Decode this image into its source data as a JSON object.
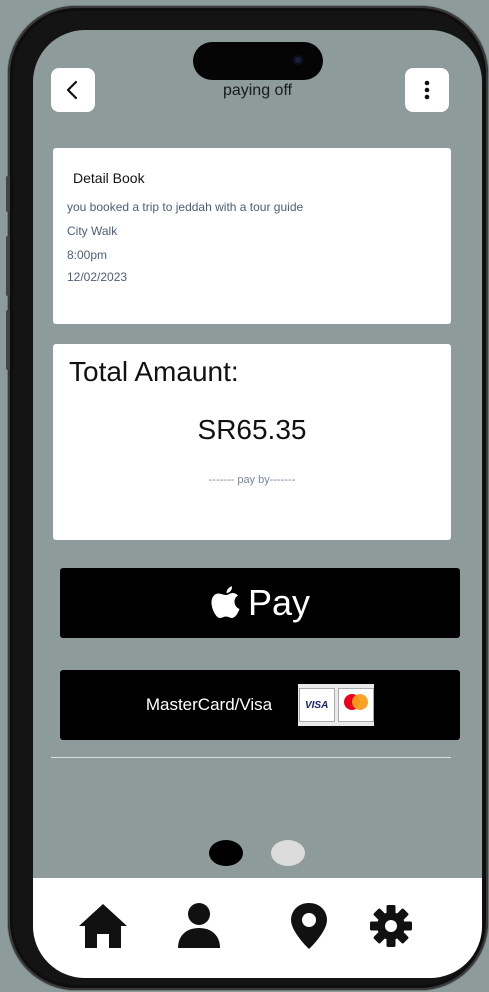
{
  "header": {
    "title": "paying off",
    "back_icon": "chevron-left-icon",
    "menu_icon": "more-vertical-icon"
  },
  "detail": {
    "heading": "Detail Book",
    "description": "you booked a trip to jeddah with a tour guide",
    "place": "City Walk",
    "time": "8:00pm",
    "date": "12/02/2023"
  },
  "total": {
    "label": "Total Amaunt:",
    "amount": "SR65.35",
    "pay_by": "------- pay by-------"
  },
  "payments": {
    "apple_pay_label": "Pay",
    "card_label": "MasterCard/Visa",
    "visa_logo_text": "VISA"
  },
  "pagination": {
    "count": 2,
    "active": 1
  },
  "tabbar": {
    "items": [
      "home-icon",
      "profile-icon",
      "location-pin-icon",
      "settings-gear-icon"
    ]
  },
  "colors": {
    "background": "#8d9b9a",
    "card": "#ffffff",
    "button": "#000000",
    "muted_text": "#4e5d78"
  }
}
